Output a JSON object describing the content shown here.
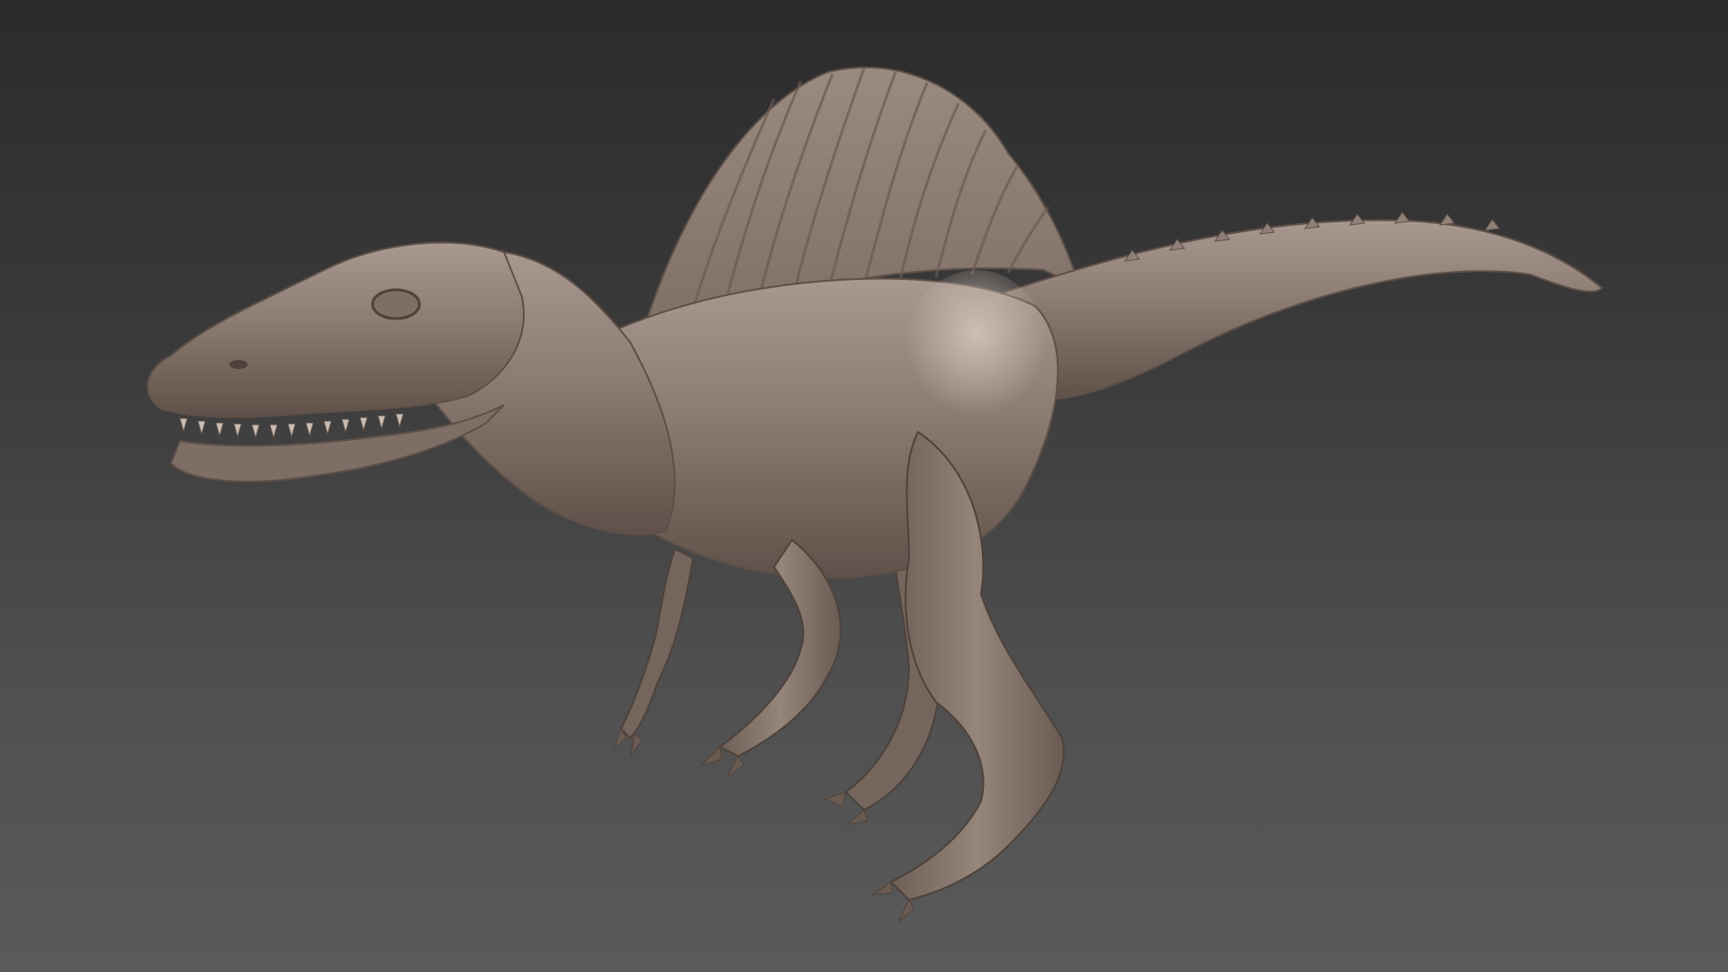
{
  "scene": {
    "subject": "spinosaurus-sculpt",
    "colors": {
      "background_top": "#2b2b2b",
      "background_bottom": "#5a5a5a",
      "clay_base": "#8a7a70",
      "clay_light": "#b3a49a",
      "clay_shadow": "#5e5048"
    }
  }
}
